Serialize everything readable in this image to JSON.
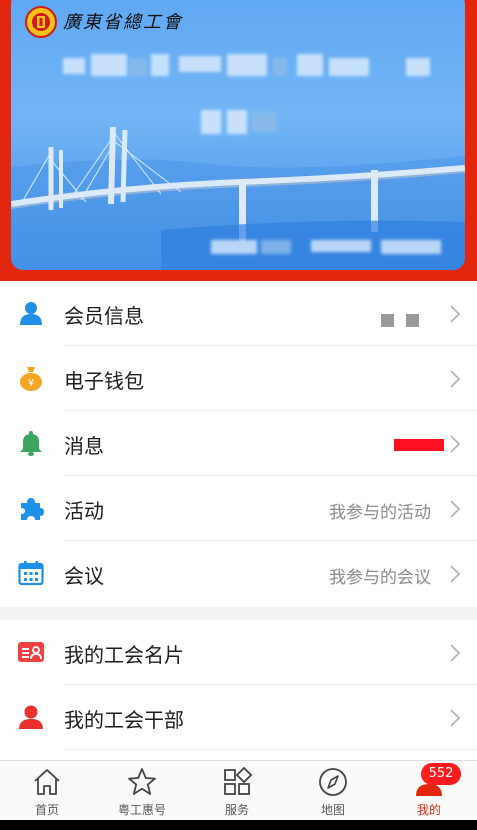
{
  "card": {
    "org_name": "廣東省總工會"
  },
  "menu": [
    {
      "label": "会员信息",
      "value": ""
    },
    {
      "label": "电子钱包",
      "value": ""
    },
    {
      "label": "消息",
      "value": ""
    },
    {
      "label": "活动",
      "value": "我参与的活动"
    },
    {
      "label": "会议",
      "value": "我参与的会议"
    },
    {
      "label": "我的工会名片",
      "value": ""
    },
    {
      "label": "我的工会干部",
      "value": ""
    }
  ],
  "tabs": [
    {
      "label": "首页"
    },
    {
      "label": "粤工惠号"
    },
    {
      "label": "服务"
    },
    {
      "label": "地图"
    },
    {
      "label": "我的"
    }
  ],
  "badge": "552",
  "colors": {
    "brand_red": "#e3270f",
    "card_blue": "#5fa7f2",
    "icon_user": "#1e90e8",
    "icon_wallet": "#f5a623",
    "icon_bell": "#3aa55c",
    "icon_puzzle": "#1e90e8",
    "icon_calendar": "#1e90e8",
    "icon_card": "#f04141",
    "icon_cadre": "#e9302a"
  }
}
